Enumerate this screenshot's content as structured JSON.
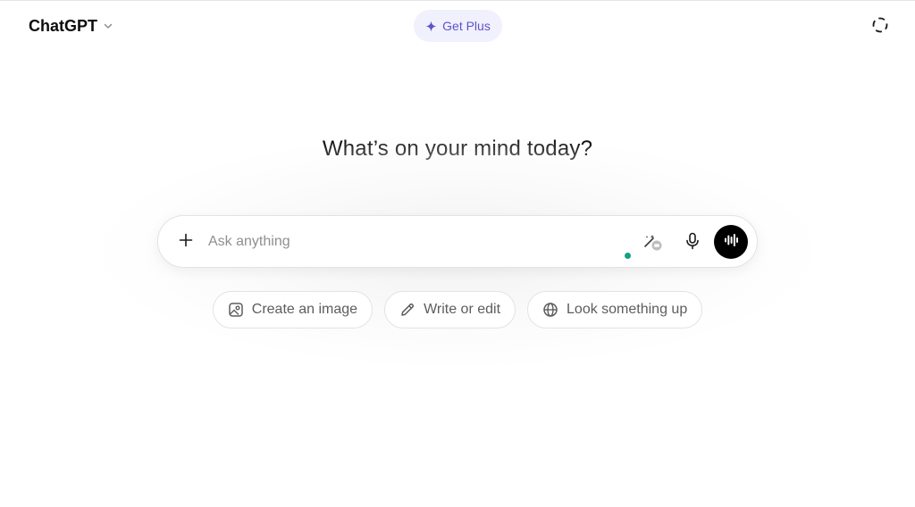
{
  "header": {
    "model_title": "ChatGPT",
    "model_chevron_icon": "chevron-down-icon",
    "get_plus_label": "Get Plus",
    "get_plus_icon": "sparkle-icon",
    "temp_chat_icon": "dashed-circle-icon"
  },
  "main": {
    "headline": "What’s on your mind today?"
  },
  "composer": {
    "placeholder": "Ask anything",
    "value": "",
    "attach_icon": "plus-icon",
    "tools_icon": "magic-wand-icon",
    "mic_icon": "microphone-icon",
    "voice_icon": "voice-waveform-icon"
  },
  "suggestions": [
    {
      "label": "Create an image",
      "icon": "image-icon"
    },
    {
      "label": "Write or edit",
      "icon": "pencil-icon"
    },
    {
      "label": "Look something up",
      "icon": "globe-icon"
    }
  ],
  "colors": {
    "accent_plus": "#5a55c8",
    "accent_plus_bg": "#f1f0fd",
    "status_dot": "#10a37f",
    "voice_button": "#000000"
  }
}
